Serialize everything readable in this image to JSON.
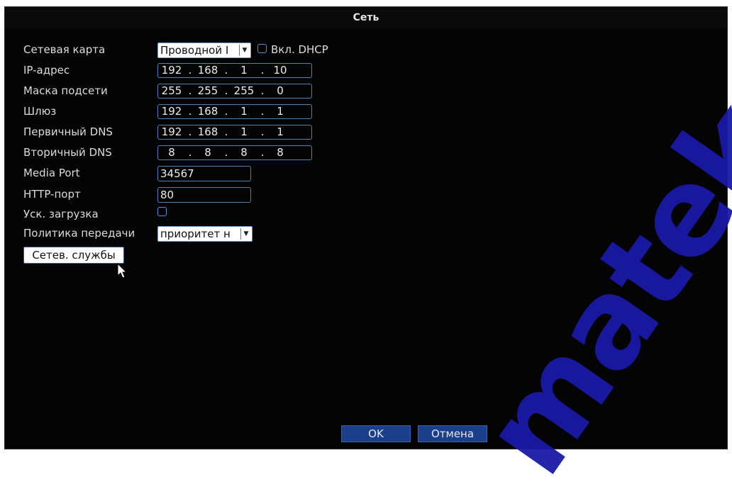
{
  "window": {
    "title": "Сеть"
  },
  "form": {
    "network_card": {
      "label": "Сетевая карта",
      "value": "Проводной I",
      "dhcp_label": "Вкл. DHCP",
      "dhcp_checked": false
    },
    "ip": {
      "label": "IP-адрес",
      "octets": [
        "192",
        "168",
        "1",
        "10"
      ]
    },
    "mask": {
      "label": "Маска подсети",
      "octets": [
        "255",
        "255",
        "255",
        "0"
      ]
    },
    "gateway": {
      "label": "Шлюз",
      "octets": [
        "192",
        "168",
        "1",
        "1"
      ]
    },
    "dns1": {
      "label": "Первичный DNS",
      "octets": [
        "192",
        "168",
        "1",
        "1"
      ]
    },
    "dns2": {
      "label": "Вторичный DNS",
      "octets": [
        "8",
        "8",
        "8",
        "8"
      ]
    },
    "media_port": {
      "label": "Media Port",
      "value": "34567"
    },
    "http_port": {
      "label": "HTTP-порт",
      "value": "80"
    },
    "fast_download": {
      "label": "Уск. загрузка",
      "checked": false
    },
    "transfer_policy": {
      "label": "Политика передачи",
      "value": "приоритет н"
    },
    "net_services_button": "Сетев. службы"
  },
  "buttons": {
    "ok": "OK",
    "cancel": "Отмена"
  },
  "separator": ".",
  "icons": {
    "dropdown": "chevron-down-icon",
    "cursor": "mouse-pointer-icon"
  },
  "watermark": "matek",
  "colors": {
    "window_bg": "#040404",
    "field_border": "#4d7fb8",
    "button_bg": "#1c3f8c",
    "watermark": "#1a1aa8"
  }
}
